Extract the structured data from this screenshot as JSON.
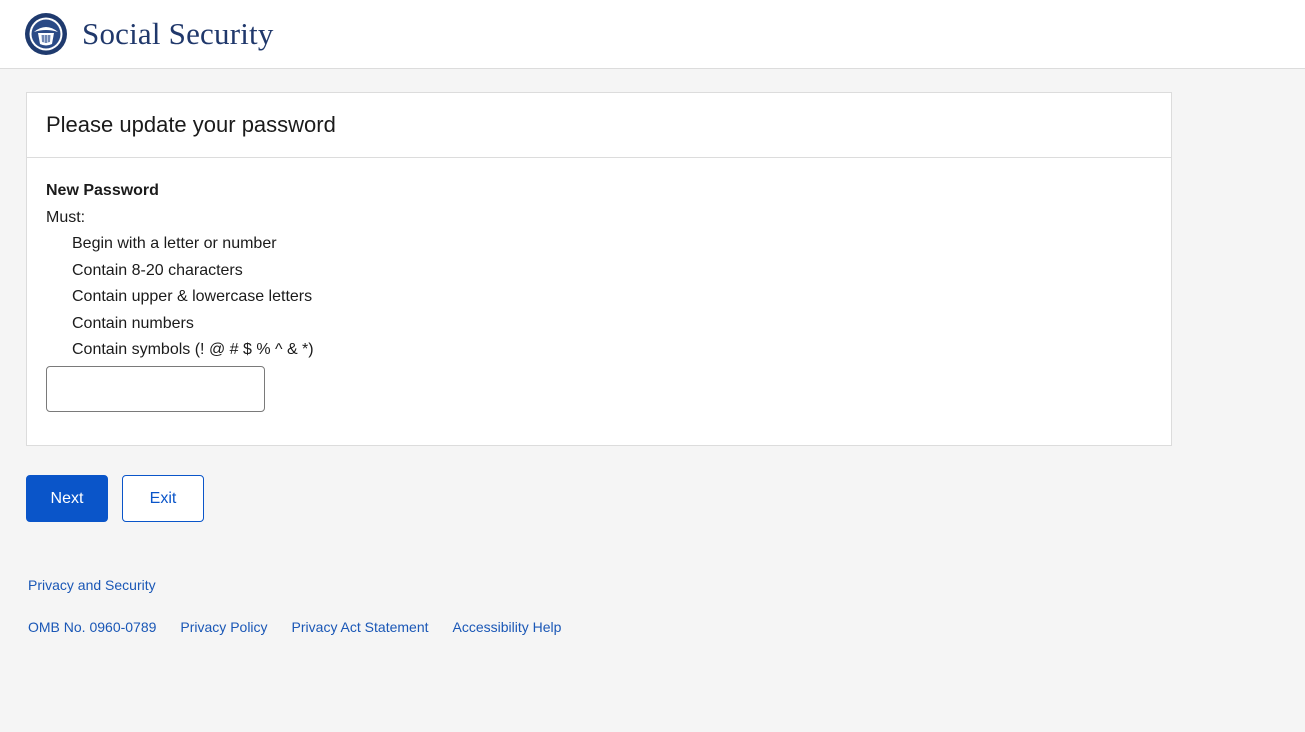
{
  "header": {
    "brand": "Social Security",
    "logo_icon": "ssa-seal-icon"
  },
  "card": {
    "title": "Please update your password",
    "field_label": "New Password",
    "must_label": "Must:",
    "requirements": [
      "Begin with a letter or number",
      "Contain 8-20 characters",
      "Contain upper & lowercase letters",
      "Contain numbers",
      "Contain symbols (! @ # $ % ^ & *)"
    ],
    "password_value": "",
    "password_placeholder": ""
  },
  "buttons": {
    "next": "Next",
    "exit": "Exit"
  },
  "footer": {
    "privacy_security": "Privacy and Security",
    "omb": "OMB No. 0960-0789",
    "privacy_policy": "Privacy Policy",
    "privacy_act": "Privacy Act Statement",
    "accessibility": "Accessibility Help"
  },
  "colors": {
    "brand_navy": "#20386b",
    "primary_blue": "#0a55c9",
    "link_blue": "#1a57b6",
    "page_bg": "#f5f5f5"
  }
}
